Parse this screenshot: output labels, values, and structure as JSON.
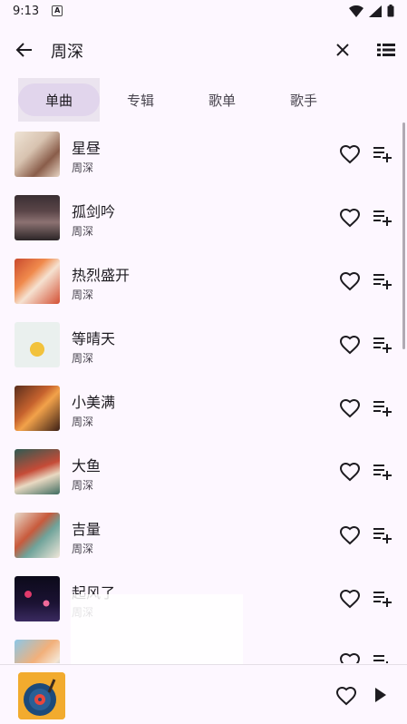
{
  "status": {
    "time": "9:13",
    "notif_letter": "A"
  },
  "search": {
    "query": "周深"
  },
  "tabs": [
    {
      "label": "单曲"
    },
    {
      "label": "专辑"
    },
    {
      "label": "歌单"
    },
    {
      "label": "歌手"
    }
  ],
  "songs": [
    {
      "title": "星昼",
      "artist": "周深"
    },
    {
      "title": "孤剑吟",
      "artist": "周深"
    },
    {
      "title": "热烈盛开",
      "artist": "周深"
    },
    {
      "title": "等晴天",
      "artist": "周深"
    },
    {
      "title": "小美满",
      "artist": "周深"
    },
    {
      "title": "大鱼",
      "artist": "周深"
    },
    {
      "title": "吉量",
      "artist": "周深"
    },
    {
      "title": "起风了",
      "artist": "周深"
    },
    {
      "title": "",
      "artist": ""
    }
  ],
  "colors": {
    "background": "#fdf7ff",
    "active_tab": "#e1d5ec",
    "text_primary": "#1d1b20",
    "text_secondary": "#49454f"
  }
}
